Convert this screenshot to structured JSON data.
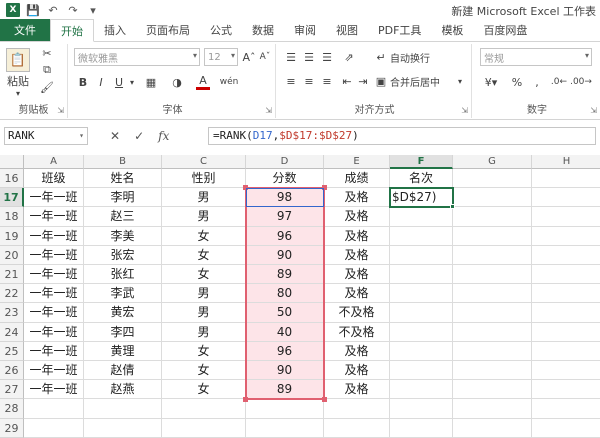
{
  "window": {
    "title": "新建 Microsoft Excel 工作表"
  },
  "tabs": [
    {
      "label": "文件"
    },
    {
      "label": "开始"
    },
    {
      "label": "插入"
    },
    {
      "label": "页面布局"
    },
    {
      "label": "公式"
    },
    {
      "label": "数据"
    },
    {
      "label": "审阅"
    },
    {
      "label": "视图"
    },
    {
      "label": "PDF工具"
    },
    {
      "label": "模板"
    },
    {
      "label": "百度网盘"
    }
  ],
  "ribbon": {
    "clipboard": {
      "label": "剪贴板",
      "paste": "粘贴"
    },
    "font": {
      "label": "字体",
      "name": "微软雅黑",
      "size": "12"
    },
    "alignment": {
      "label": "对齐方式",
      "wrap": "自动换行",
      "merge": "合并后居中"
    },
    "number": {
      "label": "数字",
      "format": "常规"
    }
  },
  "formula_bar": {
    "name_box": "RANK",
    "formula_prefix": "=RANK(",
    "formula_ref": "D17",
    "formula_sep": ",",
    "formula_range": "$D$17:$D$27",
    "formula_suffix": ")"
  },
  "sheet": {
    "columns": [
      "A",
      "B",
      "C",
      "D",
      "E",
      "F",
      "G",
      "H"
    ],
    "selected_column": "F",
    "header_row": {
      "row": "16",
      "cells": [
        "班级",
        "姓名",
        "性别",
        "分数",
        "成绩",
        "名次"
      ]
    },
    "rows": [
      {
        "row": "17",
        "cells": [
          "一年一班",
          "李明",
          "男",
          "98",
          "及格",
          "$D$27)"
        ]
      },
      {
        "row": "18",
        "cells": [
          "一年一班",
          "赵三",
          "男",
          "97",
          "及格",
          ""
        ]
      },
      {
        "row": "19",
        "cells": [
          "一年一班",
          "李美",
          "女",
          "96",
          "及格",
          ""
        ]
      },
      {
        "row": "20",
        "cells": [
          "一年一班",
          "张宏",
          "女",
          "90",
          "及格",
          ""
        ]
      },
      {
        "row": "21",
        "cells": [
          "一年一班",
          "张红",
          "女",
          "89",
          "及格",
          ""
        ]
      },
      {
        "row": "22",
        "cells": [
          "一年一班",
          "李武",
          "男",
          "80",
          "及格",
          ""
        ]
      },
      {
        "row": "23",
        "cells": [
          "一年一班",
          "黄宏",
          "男",
          "50",
          "不及格",
          ""
        ]
      },
      {
        "row": "24",
        "cells": [
          "一年一班",
          "李四",
          "男",
          "40",
          "不及格",
          ""
        ]
      },
      {
        "row": "25",
        "cells": [
          "一年一班",
          "黄理",
          "女",
          "96",
          "及格",
          ""
        ]
      },
      {
        "row": "26",
        "cells": [
          "一年一班",
          "赵倩",
          "女",
          "90",
          "及格",
          ""
        ]
      },
      {
        "row": "27",
        "cells": [
          "一年一班",
          "赵燕",
          "女",
          "89",
          "及格",
          ""
        ]
      },
      {
        "row": "28",
        "cells": [
          "",
          "",
          "",
          "",
          "",
          ""
        ]
      },
      {
        "row": "29",
        "cells": [
          "",
          "",
          "",
          "",
          "",
          ""
        ]
      }
    ],
    "active_cell": "F17",
    "reference_range": "D17:D27"
  }
}
